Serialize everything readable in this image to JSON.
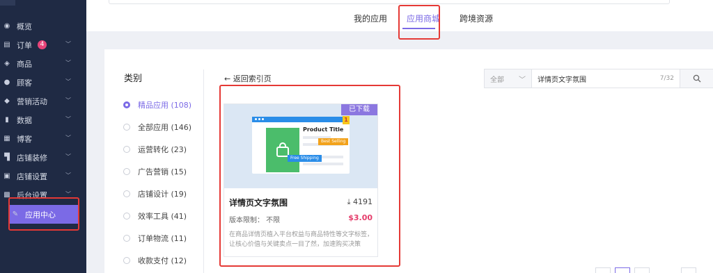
{
  "sidebar": {
    "items": [
      {
        "label": "概览",
        "icon": "dashboard-icon",
        "has_chevron": false
      },
      {
        "label": "订单",
        "icon": "order-icon",
        "badge": "4",
        "has_chevron": true
      },
      {
        "label": "商品",
        "icon": "box-icon",
        "has_chevron": true
      },
      {
        "label": "顾客",
        "icon": "user-icon",
        "has_chevron": true
      },
      {
        "label": "营销活动",
        "icon": "tag-icon",
        "has_chevron": true
      },
      {
        "label": "数据",
        "icon": "chart-icon",
        "has_chevron": true
      },
      {
        "label": "博客",
        "icon": "blog-icon",
        "has_chevron": true
      },
      {
        "label": "店铺装修",
        "icon": "paint-roller-icon",
        "has_chevron": true
      },
      {
        "label": "店铺设置",
        "icon": "store-icon",
        "has_chevron": true
      },
      {
        "label": "后台设置",
        "icon": "settings-icon",
        "has_chevron": true
      },
      {
        "label": "应用中心",
        "icon": "wrench-icon",
        "active": true
      }
    ]
  },
  "header": {
    "tabs": [
      {
        "label": "我的应用",
        "active": false
      },
      {
        "label": "应用商城",
        "active": true
      },
      {
        "label": "跨境资源",
        "active": false
      }
    ]
  },
  "categories": {
    "title": "类别",
    "items": [
      {
        "label": "精品应用 (108)",
        "selected": true
      },
      {
        "label": "全部应用 (146)",
        "selected": false
      },
      {
        "label": "运营转化 (23)",
        "selected": false
      },
      {
        "label": "广告营销 (15)",
        "selected": false
      },
      {
        "label": "店铺设计 (19)",
        "selected": false
      },
      {
        "label": "效率工具 (41)",
        "selected": false
      },
      {
        "label": "订单物流 (11)",
        "selected": false
      },
      {
        "label": "收款支付 (12)",
        "selected": false
      }
    ]
  },
  "back_link": "← 返回索引页",
  "filter": {
    "select_value": "全部",
    "search_value": "详情页文字氛围",
    "char_count": "7/32"
  },
  "card": {
    "ribbon": "已下载",
    "preview": {
      "product_title": "Product Title",
      "best_selling": "Best Selling",
      "free_shipping": "Free Shipping",
      "rank_badge": "1"
    },
    "name": "详情页文字氛围",
    "downloads": "4191",
    "version": "版本限制：  不限",
    "price": "$3.00",
    "description": "在商品详情页植入平台权益与商品特性等文字标签，让核心价值与关键卖点一目了然，加速购买决策"
  },
  "colors": {
    "sidebar_bg": "#1f2a44",
    "accent": "#7b6ae6",
    "price": "#e53d6b",
    "highlight": "#e53935"
  }
}
